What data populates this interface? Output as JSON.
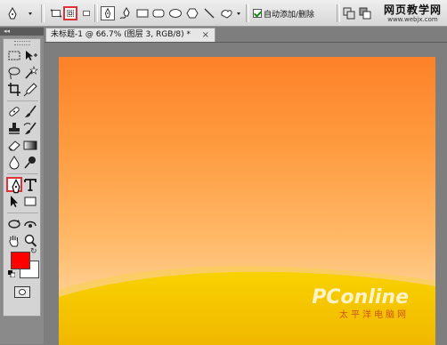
{
  "options_bar": {
    "tool_icon": "pen-icon",
    "mode_buttons": [
      "shape-layers-icon",
      "paths-icon",
      "fill-pixels-icon"
    ],
    "shape_buttons": [
      "pen-icon",
      "freeform-pen-icon",
      "rectangle-icon",
      "rounded-rectangle-icon",
      "ellipse-icon",
      "polygon-icon",
      "line-icon",
      "custom-shape-icon"
    ],
    "auto_add_delete_label": "自动添加/删除",
    "auto_add_delete_checked": true
  },
  "watermark": {
    "title": "网页教学网",
    "url": "www.webjx.com"
  },
  "toolbox": {
    "collapse_label": "◂◂",
    "foreground_color": "#ff0000",
    "background_color": "#ffffff"
  },
  "document": {
    "tab_title": "未标题-1 @ 66.7% (图层 3, RGB/8) *",
    "close_label": "×"
  },
  "canvas": {
    "gradient_top": "#fd8128",
    "gradient_bottom": "#ffe3b6",
    "hill_color": "#f5c800",
    "logo_text": "PConline",
    "logo_sub": "太平洋电脑网"
  }
}
